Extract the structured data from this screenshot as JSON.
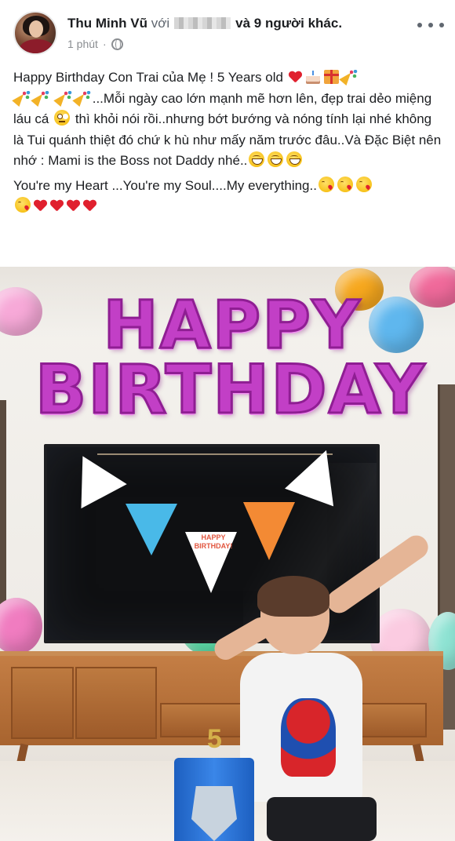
{
  "post": {
    "author": "Thu Minh Vũ",
    "with_word": "với",
    "and_others": "và 9 người khác.",
    "time": "1 phút",
    "dot": "·",
    "privacy_icon": "globe-icon",
    "more_icon": "more-dots-icon"
  },
  "caption": {
    "line1_text": "Happy Birthday Con Trai của Mẹ ! 5 Years old",
    "line2_text": "...Mỗi ngày cao lớn mạnh mẽ hơn lên, đẹp trai dẻo miệng láu cá",
    "line2_cont": " thì khỏi nói rồi..nhưng bớt bướng và nóng tính lại nhé không là Tui quánh thiệt đó chứ k hù như mấy năm trước đâu..Và Đặc Biệt nên nhớ : Mami is the Boss not Daddy nhé..",
    "line3_text": "You're my Heart ...You're my Soul....My everything..",
    "emojis": [
      "red-heart",
      "birthday-cake",
      "wrapped-gift",
      "party-popper",
      "grinning-face",
      "face-with-rolling-eyes",
      "face-blowing-a-kiss"
    ]
  },
  "photo": {
    "banner_row1": "HAPPY",
    "banner_row2": "BIRTHDAY",
    "flag_text": "HAPPY BIRTHDAY!",
    "cake_number": "5",
    "colors": {
      "letter_fill": "#c23fc6",
      "letter_stroke": "#8f1e93",
      "stand_wood": "#b06c34",
      "tv_black": "#0f1012",
      "cake_blue": "#1d5fc0"
    }
  }
}
